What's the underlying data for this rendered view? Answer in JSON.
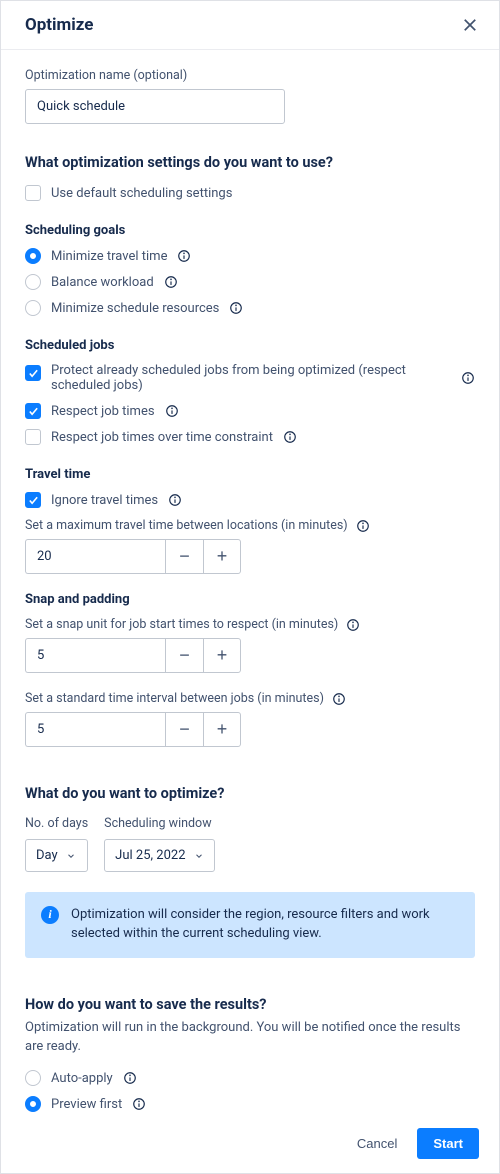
{
  "header": {
    "title": "Optimize"
  },
  "name_field": {
    "label": "Optimization name (optional)",
    "value": "Quick schedule"
  },
  "settings": {
    "heading": "What optimization settings do you want to use?",
    "use_default": "Use default scheduling settings"
  },
  "goals": {
    "heading": "Scheduling goals",
    "minimize_travel": "Minimize travel time",
    "balance_workload": "Balance workload",
    "minimize_resources": "Minimize schedule resources"
  },
  "jobs": {
    "heading": "Scheduled jobs",
    "protect": "Protect already scheduled jobs from being optimized (respect scheduled jobs)",
    "respect_times": "Respect job times",
    "respect_over_constraint": "Respect job times over time constraint"
  },
  "travel": {
    "heading": "Travel time",
    "ignore": "Ignore travel times",
    "max_label": "Set a maximum travel time between locations (in minutes)",
    "max_value": "20"
  },
  "snap": {
    "heading": "Snap and padding",
    "snap_label": "Set a snap unit for job start times to respect (in minutes)",
    "snap_value": "5",
    "interval_label": "Set a standard time interval between jobs (in minutes)",
    "interval_value": "5"
  },
  "optimize_what": {
    "heading": "What do you want to optimize?",
    "days_label": "No. of days",
    "days_value": "Day",
    "window_label": "Scheduling window",
    "window_value": "Jul 25, 2022",
    "banner": "Optimization will consider the region, resource filters and work selected within the current scheduling view."
  },
  "save": {
    "heading": "How do you want to save the results?",
    "subtext": "Optimization will run in the background. You will be notified once the results are ready.",
    "auto_apply": "Auto-apply",
    "preview": "Preview first"
  },
  "footer": {
    "cancel": "Cancel",
    "start": "Start"
  }
}
